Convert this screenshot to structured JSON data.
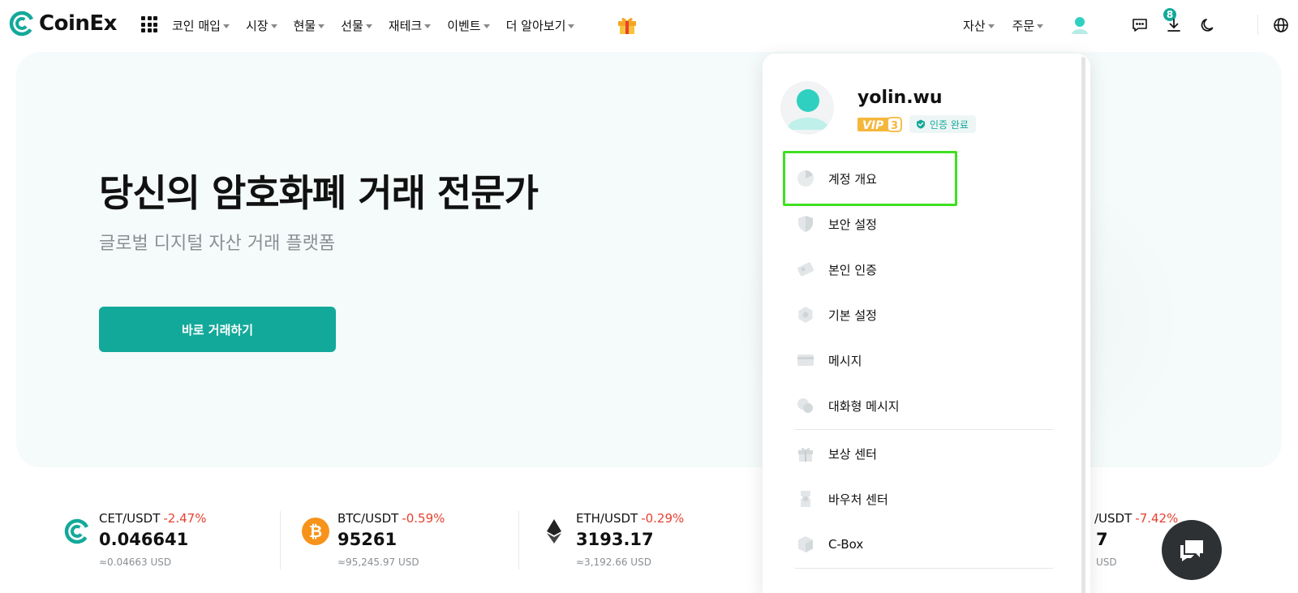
{
  "brand": {
    "name": "CoinEx",
    "accent": "#13a99a"
  },
  "nav": {
    "items": [
      {
        "label": "코인 매입"
      },
      {
        "label": "시장"
      },
      {
        "label": "현물"
      },
      {
        "label": "선물"
      },
      {
        "label": "재테크"
      },
      {
        "label": "이벤트"
      },
      {
        "label": "더 알아보기"
      }
    ],
    "right": [
      {
        "label": "자산"
      },
      {
        "label": "주문"
      }
    ],
    "notification_count": "8",
    "icons": [
      "apps-grid-icon",
      "gift-icon",
      "avatar-icon",
      "chat-icon",
      "download-icon",
      "moon-icon",
      "globe-icon"
    ]
  },
  "hero": {
    "title": "당신의 암호화폐 거래 전문가",
    "subtitle": "글로벌 디지털 자산 거래 플랫폼",
    "cta_label": "바로 거래하기"
  },
  "ticker": [
    {
      "pair": "CET/USDT",
      "change": "-2.47%",
      "price": "0.046641",
      "usd": "≈0.04663 USD",
      "icon": "cet-icon"
    },
    {
      "pair": "BTC/USDT",
      "change": "-0.59%",
      "price": "95261",
      "usd": "≈95,245.97 USD",
      "icon": "btc-icon"
    },
    {
      "pair": "ETH/USDT",
      "change": "-0.29%",
      "price": "3193.17",
      "usd": "≈3,192.66 USD",
      "icon": "eth-icon"
    },
    {
      "pair": "/USDT",
      "change": "-7.42%",
      "price": "7",
      "usd": "USD",
      "icon": ""
    }
  ],
  "account_menu": {
    "username": "yolin.wu",
    "vip_label": "VIP",
    "vip_level": "3",
    "verified_label": "인증 완료",
    "items": [
      {
        "label": "계정 개요",
        "icon": "pie-chart-icon"
      },
      {
        "label": "보안 설정",
        "icon": "shield-icon"
      },
      {
        "label": "본인 인증",
        "icon": "id-card-icon"
      },
      {
        "label": "기본 설정",
        "icon": "gear-icon"
      },
      {
        "label": "메시지",
        "icon": "envelope-icon"
      },
      {
        "label": "대화형 메시지",
        "icon": "chat-bubbles-icon"
      }
    ],
    "items2": [
      {
        "label": "보상 센터",
        "icon": "gift-box-icon"
      },
      {
        "label": "바우처 센터",
        "icon": "voucher-icon"
      },
      {
        "label": "C-Box",
        "icon": "box-icon"
      }
    ]
  },
  "colors": {
    "negative": "#e8402f",
    "highlight": "#3fe022",
    "muted": "#8a8f94"
  }
}
